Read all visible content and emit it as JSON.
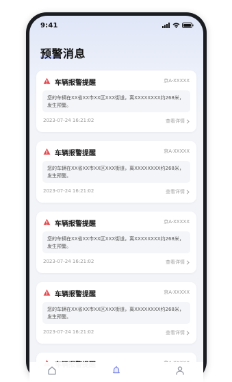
{
  "status_bar": {
    "time": "9:41"
  },
  "page": {
    "title": "预警消息"
  },
  "alerts": [
    {
      "title": "车辆报警提醒",
      "plate": "京A-XXXXX",
      "message": "您的车辆在XX省XX市XX区XXX街道，离XXXXXXXX约268米，发生预警。",
      "time": "2023-07-24 16:21:02",
      "detail_label": "查看详情"
    },
    {
      "title": "车辆报警提醒",
      "plate": "京A-XXXXX",
      "message": "您的车辆在XX省XX市XX区XXX街道，离XXXXXXXX约268米，发生预警。",
      "time": "2023-07-24 16:21:02",
      "detail_label": "查看详情"
    },
    {
      "title": "车辆报警提醒",
      "plate": "京A-XXXXX",
      "message": "您的车辆在XX省XX市XX区XXX街道，离XXXXXXXX约268米，发生预警。",
      "time": "2023-07-24 16:21:02",
      "detail_label": "查看详情"
    },
    {
      "title": "车辆报警提醒",
      "plate": "京A-XXXXX",
      "message": "您的车辆在XX省XX市XX区XXX街道，离XXXXXXXX约268米，发生预警。",
      "time": "2023-07-24 16:21:02",
      "detail_label": "查看详情"
    },
    {
      "title": "车辆报警提醒",
      "plate": "京A-XXXXX"
    }
  ],
  "tab_bar": {
    "tabs": [
      {
        "icon": "home-icon",
        "active": false
      },
      {
        "icon": "bell-icon",
        "active": true
      },
      {
        "icon": "user-icon",
        "active": false
      }
    ]
  },
  "colors": {
    "accent": "#7b86e8",
    "warning": "#e5484d",
    "background": "#f3f4f8"
  }
}
